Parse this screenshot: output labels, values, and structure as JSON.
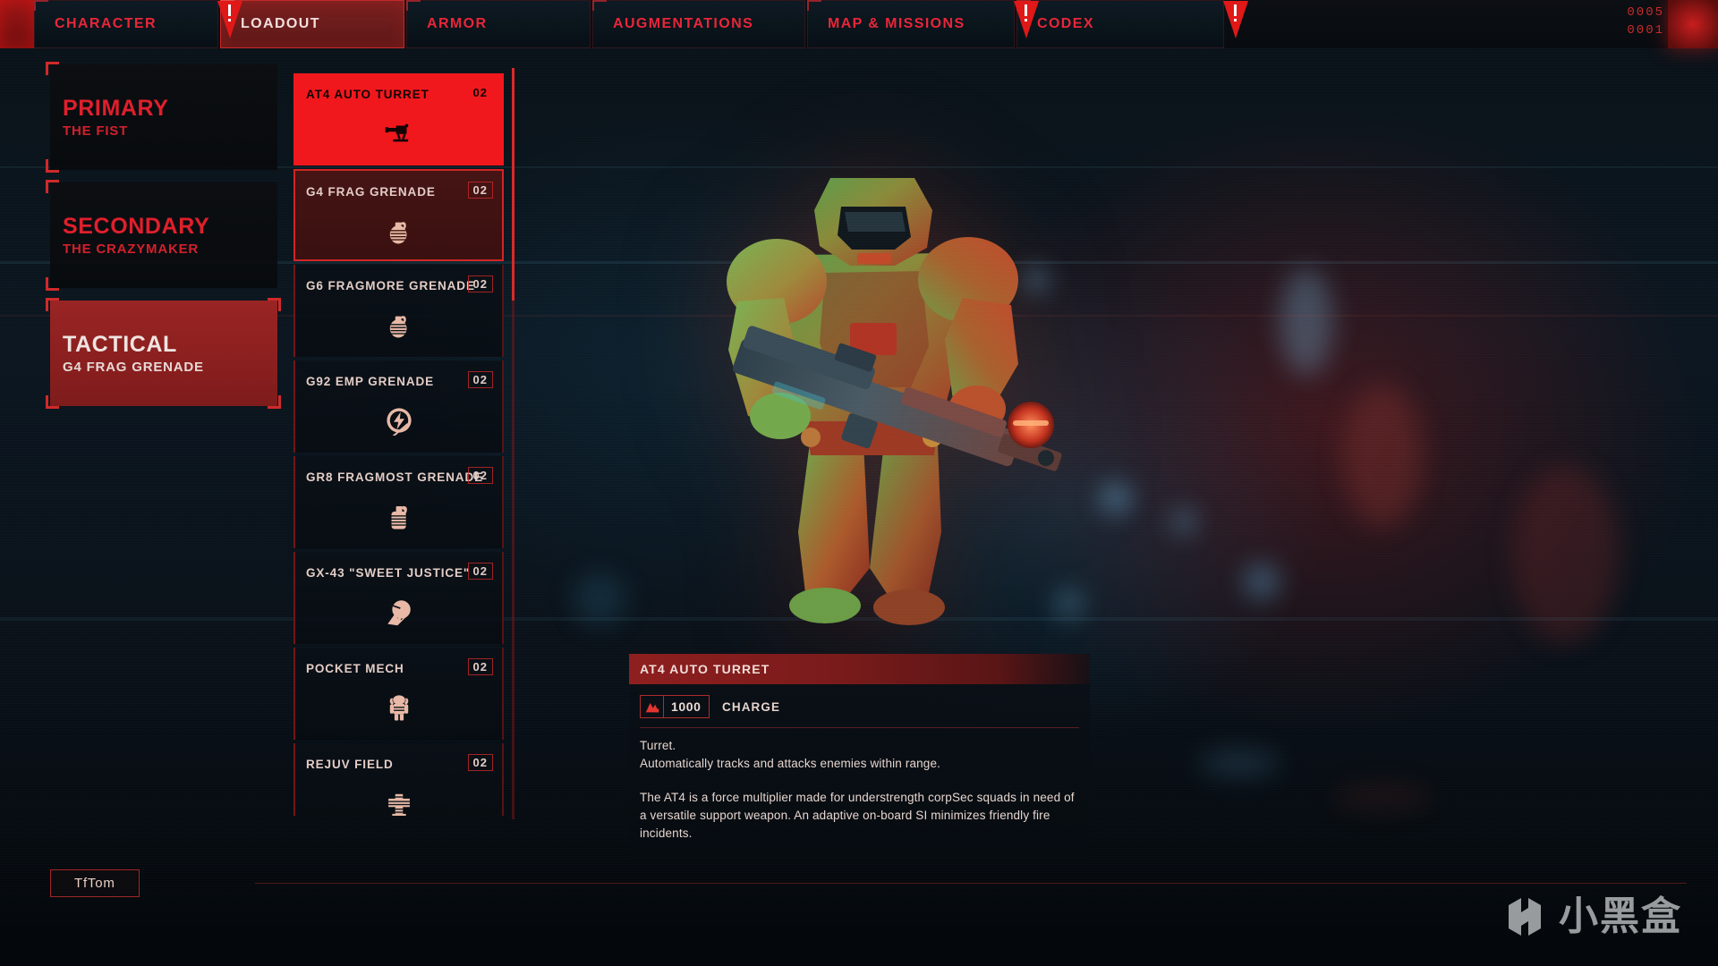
{
  "colors": {
    "accent_red": "#e01f2c",
    "bright_red": "#f1181d",
    "tab_active_bg": "#7a2020",
    "item_icon": "#e8b9a6",
    "text_cream": "#e3cdc6"
  },
  "tabbar": {
    "tabs": [
      {
        "label": "CHARACTER",
        "active": false,
        "flag": true
      },
      {
        "label": "LOADOUT",
        "active": true,
        "flag": false
      },
      {
        "label": "ARMOR",
        "active": false,
        "flag": false
      },
      {
        "label": "AUGMENTATIONS",
        "active": false,
        "flag": false
      },
      {
        "label": "MAP & MISSIONS",
        "active": false,
        "flag": true
      },
      {
        "label": "CODEX",
        "active": false,
        "flag": true
      }
    ],
    "counters": [
      "0005",
      "0001"
    ]
  },
  "slots": [
    {
      "title": "PRIMARY",
      "sub": "THE FIST",
      "selected": false
    },
    {
      "title": "SECONDARY",
      "sub": "THE CRAZYMAKER",
      "selected": false
    },
    {
      "title": "TACTICAL",
      "sub": "G4 FRAG GRENADE",
      "selected": true
    }
  ],
  "items": [
    {
      "name": "AT4 AUTO TURRET",
      "count": "02",
      "icon": "turret-icon",
      "state": "highlight"
    },
    {
      "name": "G4 FRAG GRENADE",
      "count": "02",
      "icon": "grenade-icon",
      "state": "equipped"
    },
    {
      "name": "G6 FRAGMORE GRENADE",
      "count": "02",
      "icon": "grenade-icon",
      "state": "normal"
    },
    {
      "name": "G92 EMP GRENADE",
      "count": "02",
      "icon": "emp-icon",
      "state": "normal"
    },
    {
      "name": "GR8 FRAGMOST GRENADE",
      "count": "02",
      "icon": "grenade-icon",
      "state": "normal"
    },
    {
      "name": "GX-43 \"SWEET JUSTICE\"",
      "count": "02",
      "icon": "shockwave-icon",
      "state": "normal"
    },
    {
      "name": "POCKET MECH",
      "count": "02",
      "icon": "mech-icon",
      "state": "normal"
    },
    {
      "name": "REJUV FIELD",
      "count": "02",
      "icon": "medcross-icon",
      "state": "normal"
    }
  ],
  "tooltip": {
    "title": "AT4 AUTO TURRET",
    "stat_value": "1000",
    "stat_label": "CHARGE",
    "paragraph1": "Turret.\nAutomatically tracks and attacks enemies within range.",
    "paragraph2": "The AT4 is a force multiplier made for understrength corpSec squads in need of a versatile support weapon. An adaptive on-board SI minimizes friendly fire incidents."
  },
  "bottom": {
    "nav_button": "TfTom"
  },
  "watermark": {
    "text": "小黑盒"
  }
}
